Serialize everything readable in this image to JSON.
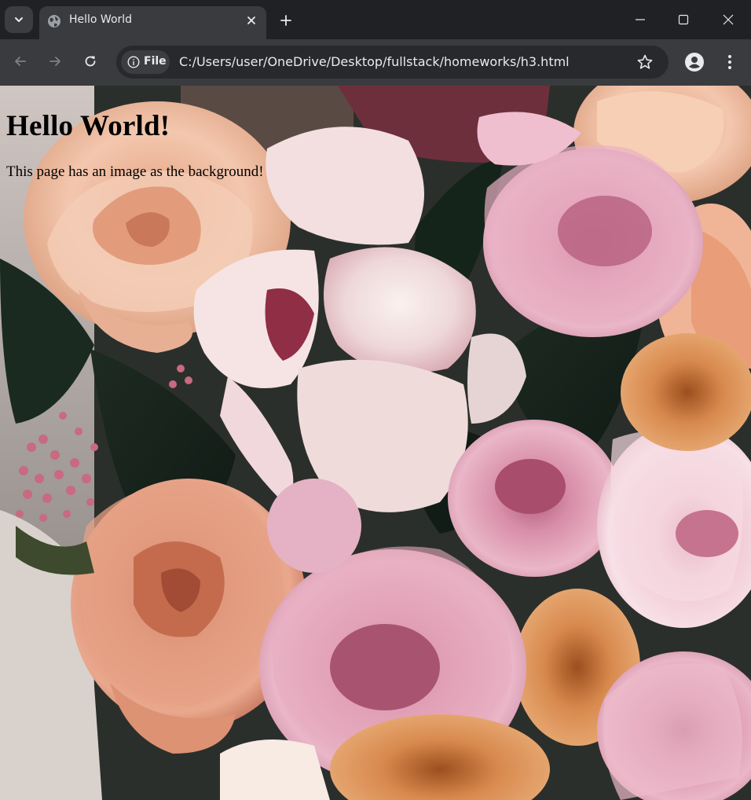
{
  "browser": {
    "tab": {
      "title": "Hello World",
      "favicon": "globe-icon"
    },
    "address_bar": {
      "chip_label": "File",
      "url": "C:/Users/user/OneDrive/Desktop/fullstack/homeworks/h3.html"
    },
    "icons": {
      "tab_search": "chevron-down-icon",
      "close_tab": "close-icon",
      "new_tab": "plus-icon",
      "minimize": "minimize-icon",
      "maximize": "maximize-icon",
      "close_window": "close-icon",
      "back": "arrow-left-icon",
      "forward": "arrow-right-icon",
      "reload": "reload-icon",
      "site_info": "info-icon",
      "bookmark": "star-icon",
      "profile": "person-icon",
      "menu": "kebab-menu-icon"
    },
    "colors": {
      "frame": "#202124",
      "toolbar": "#3a3b3e",
      "omnibox": "#28292c",
      "text": "#e8eaed"
    }
  },
  "page": {
    "heading": "Hello World!",
    "paragraph": "This page has an image as the background!",
    "text_color": "#000000"
  }
}
